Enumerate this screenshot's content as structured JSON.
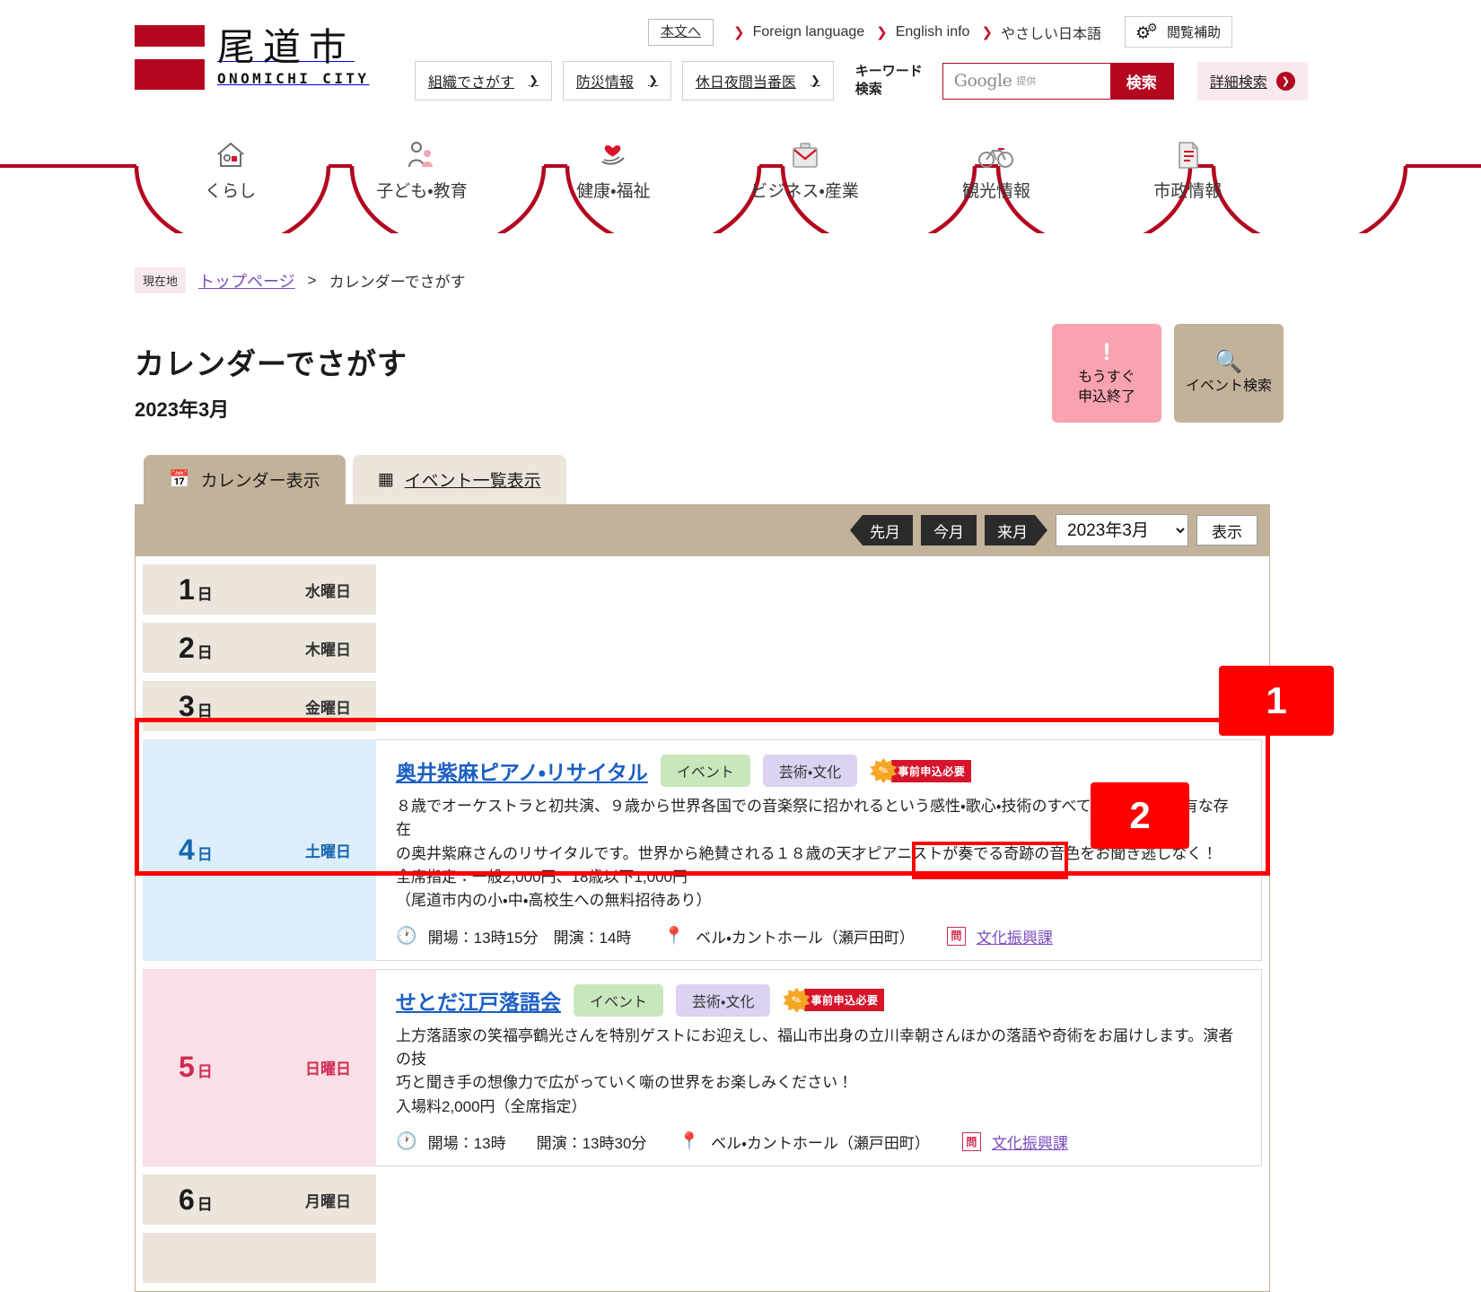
{
  "header": {
    "logo": {
      "name_ja": "尾道市",
      "name_en": "ONOMICHI CITY"
    },
    "skip_link": "本文へ",
    "lang_links": [
      "Foreign language",
      "English info",
      "やさしい日本語"
    ],
    "assist_button": "閲覧補助",
    "nav_buttons": [
      "組織でさがす",
      "防災情報",
      "休日夜間当番医"
    ],
    "keyword_label_line1": "キーワード",
    "keyword_label_line2": "検索",
    "search_placeholder": "Google",
    "search_placeholder_sub": "提供",
    "search_submit": "検索",
    "advanced_search": "詳細検索"
  },
  "gnav": [
    {
      "label": "くらし",
      "icon": "house-icon"
    },
    {
      "label": "子ども・教育",
      "icon": "parent-child-icon"
    },
    {
      "label": "健康・福祉",
      "icon": "heart-hand-icon"
    },
    {
      "label": "ビジネス・産業",
      "icon": "briefcase-icon"
    },
    {
      "label": "観光情報",
      "icon": "bicycle-icon"
    },
    {
      "label": "市政情報",
      "icon": "document-icon"
    }
  ],
  "breadcrumb": {
    "badge": "現在地",
    "home": "トップページ",
    "separator": ">",
    "current": "カレンダーでさがす"
  },
  "page": {
    "title": "カレンダーでさがす",
    "subtitle": "2023年3月"
  },
  "title_actions": [
    {
      "icon": "exclamation-icon",
      "label_line1": "もうすぐ",
      "label_line2": "申込終了",
      "color": "#f9a3b0"
    },
    {
      "icon": "magnifier-icon",
      "label_line1": "イベント検索",
      "label_line2": "",
      "color": "#c3b29a"
    }
  ],
  "tabs": [
    {
      "label": "カレンダー表示",
      "icon": "calendar-icon",
      "active": true
    },
    {
      "label": "イベント一覧表示",
      "icon": "grid-icon",
      "active": false
    }
  ],
  "toolbar": {
    "prev_month": "先月",
    "this_month": "今月",
    "next_month": "来月",
    "selected_month": "2023年3月",
    "month_options": [
      "2023年3月"
    ],
    "show_button": "表示"
  },
  "days": [
    {
      "num": "1",
      "suffix": "日",
      "weekday": "水曜日",
      "type": "weekday",
      "events": []
    },
    {
      "num": "2",
      "suffix": "日",
      "weekday": "木曜日",
      "type": "weekday",
      "events": []
    },
    {
      "num": "3",
      "suffix": "日",
      "weekday": "金曜日",
      "type": "weekday",
      "events": []
    },
    {
      "num": "4",
      "suffix": "日",
      "weekday": "土曜日",
      "type": "saturday",
      "events": [
        {
          "title": "奥井紫麻ピアノ・リサイタル",
          "tags": [
            {
              "text": "イベント",
              "color": "green"
            },
            {
              "text": "芸術・文化",
              "color": "purple"
            }
          ],
          "badge": "事前申込必要",
          "desc_lines": [
            "８歳でオーケストラと初共演、９歳から世界各国での音楽祭に招かれるという感性・歌心・技術のすべてに恵まれた稀有な存在",
            "の奥井紫麻さんのリサイタルです。世界から絶賛される１８歳の天才ピアニストが奏でる奇跡の音色をお聞き逃しなく！",
            "全席指定：一般2,000円、18歳以下1,000円",
            "（尾道市内の小・中・高校生への無料招待あり）"
          ],
          "time": "開場：13時15分　開演：14時",
          "venue": "ベル・カントホール（瀬戸田町）",
          "contact_icon_label": "問",
          "contact": "文化振興課"
        }
      ]
    },
    {
      "num": "5",
      "suffix": "日",
      "weekday": "日曜日",
      "type": "sunday",
      "events": [
        {
          "title": "せとだ江戸落語会",
          "tags": [
            {
              "text": "イベント",
              "color": "green"
            },
            {
              "text": "芸術・文化",
              "color": "purple"
            }
          ],
          "badge": "事前申込必要",
          "desc_lines": [
            "上方落語家の笑福亭鶴光さんを特別ゲストにお迎えし、福山市出身の立川幸朝さんほかの落語や奇術をお届けします。演者の技",
            "巧と聞き手の想像力で広がっていく噺の世界をお楽しみください！",
            "入場料2,000円（全席指定）"
          ],
          "time": "開場：13時　　開演：13時30分",
          "venue": "ベル・カントホール（瀬戸田町）",
          "contact_icon_label": "問",
          "contact": "文化振興課"
        }
      ]
    },
    {
      "num": "6",
      "suffix": "日",
      "weekday": "月曜日",
      "type": "weekday",
      "events": []
    }
  ],
  "annotations": [
    {
      "id": "1",
      "label": "1"
    },
    {
      "id": "2",
      "label": "2"
    }
  ],
  "colors": {
    "brand_red": "#b4061f",
    "annotation_red": "#ff0000",
    "tan": "#c3b29a",
    "tan_light": "#ece5db",
    "saturday_blue": "#dceefa",
    "sunday_pink": "#fadfe6",
    "link_blue": "#1c5fc4",
    "link_purple": "#7b4bbf"
  }
}
